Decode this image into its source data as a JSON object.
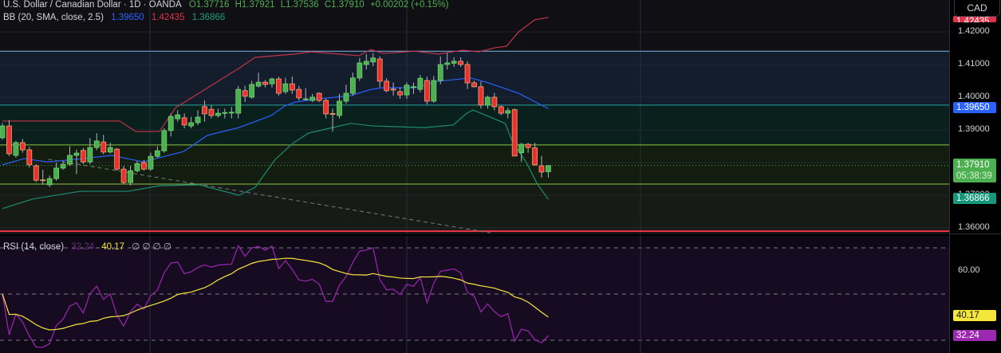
{
  "header": {
    "symbol": "U.S. Dollar / Canadian Dollar · 1D · OANDA",
    "open": "O1.37716",
    "high": "H1.37921",
    "low": "L1.37536",
    "close": "C1.37910",
    "change": "+0.00202 (+0.15%)"
  },
  "bb_legend": {
    "label": "BB (20, SMA, close, 2.5)",
    "basis": "1.39650",
    "upper": "1.42435",
    "lower": "1.36866"
  },
  "rsi_legend": {
    "label": "RSI (14, close)",
    "rsi": "32.24",
    "ma": "40.17",
    "extras": "∅ ∅ ∅ ∅"
  },
  "currency_button": "CAD",
  "price_scale": {
    "ticks": [
      "1.42000",
      "1.41000",
      "1.40000",
      "1.39000",
      "1.37000",
      "1.36000"
    ],
    "upper_badge": "1.42435",
    "basis_badge": "1.39650",
    "last_price": "1.37910",
    "countdown": "05:38:39",
    "lower_badge": "1.36866"
  },
  "rsi_scale": {
    "tick": "60.00",
    "ma_badge": "40.17",
    "rsi_badge": "32.24"
  },
  "colors": {
    "up": "#4caf50",
    "down": "#e8322f",
    "down_border": "#f7a072",
    "basis": "#2962ff",
    "upper": "#c2334a",
    "lower": "#1e8c73",
    "rsi": "#9c27b0",
    "rsi_ma": "#f5e63b"
  },
  "chart_data": {
    "type": "candlestick",
    "title": "U.S. Dollar / Canadian Dollar · 1D · OANDA",
    "ylim": [
      1.356,
      1.43
    ],
    "candles_ohlc": [
      [
        1.3876,
        1.392,
        1.387,
        1.3912
      ],
      [
        1.3912,
        1.393,
        1.382,
        1.3827
      ],
      [
        1.3822,
        1.3866,
        1.3815,
        1.3861
      ],
      [
        1.3861,
        1.3872,
        1.383,
        1.3839
      ],
      [
        1.3839,
        1.3848,
        1.3785,
        1.3793
      ],
      [
        1.379,
        1.3795,
        1.374,
        1.3746
      ],
      [
        1.3747,
        1.3778,
        1.3732,
        1.3745
      ],
      [
        1.3732,
        1.376,
        1.3725,
        1.3751
      ],
      [
        1.3751,
        1.38,
        1.3745,
        1.3783
      ],
      [
        1.3783,
        1.3805,
        1.3778,
        1.3795
      ],
      [
        1.3795,
        1.385,
        1.379,
        1.3822
      ],
      [
        1.3822,
        1.384,
        1.3765,
        1.3829
      ],
      [
        1.3837,
        1.3845,
        1.3795,
        1.3802
      ],
      [
        1.3802,
        1.3875,
        1.3795,
        1.3846
      ],
      [
        1.3846,
        1.389,
        1.3838,
        1.3866
      ],
      [
        1.3863,
        1.3885,
        1.3825,
        1.3832
      ],
      [
        1.3832,
        1.386,
        1.3828,
        1.3846
      ],
      [
        1.3841,
        1.3845,
        1.3775,
        1.378
      ],
      [
        1.378,
        1.379,
        1.3734,
        1.3739
      ],
      [
        1.3739,
        1.379,
        1.373,
        1.3775
      ],
      [
        1.3775,
        1.3805,
        1.377,
        1.3797
      ],
      [
        1.38,
        1.3808,
        1.3775,
        1.378
      ],
      [
        1.378,
        1.383,
        1.3775,
        1.3819
      ],
      [
        1.3819,
        1.385,
        1.3815,
        1.3836
      ],
      [
        1.3836,
        1.3905,
        1.383,
        1.3898
      ],
      [
        1.3898,
        1.395,
        1.388,
        1.3941
      ],
      [
        1.3934,
        1.396,
        1.3925,
        1.3946
      ],
      [
        1.3937,
        1.395,
        1.3905,
        1.3915
      ],
      [
        1.3912,
        1.394,
        1.3905,
        1.3922
      ],
      [
        1.3922,
        1.396,
        1.3915,
        1.3939
      ],
      [
        1.3971,
        1.399,
        1.3925,
        1.3949
      ],
      [
        1.3963,
        1.3975,
        1.3935,
        1.3944
      ],
      [
        1.3944,
        1.3965,
        1.3938,
        1.3951
      ],
      [
        1.3952,
        1.3965,
        1.3935,
        1.3953
      ],
      [
        1.3953,
        1.397,
        1.3935,
        1.3954
      ],
      [
        1.3951,
        1.4035,
        1.3935,
        1.4024
      ],
      [
        1.402,
        1.4035,
        1.3985,
        1.4003
      ],
      [
        1.4,
        1.405,
        1.3995,
        1.4039
      ],
      [
        1.4034,
        1.4075,
        1.403,
        1.4046
      ],
      [
        1.4046,
        1.4053,
        1.403,
        1.4039
      ],
      [
        1.4041,
        1.406,
        1.403,
        1.4056
      ],
      [
        1.4056,
        1.4063,
        1.4005,
        1.4012
      ],
      [
        1.4017,
        1.406,
        1.401,
        1.4041
      ],
      [
        1.4041,
        1.4063,
        1.401,
        1.4022
      ],
      [
        1.4024,
        1.4035,
        1.399,
        1.3998
      ],
      [
        1.3995,
        1.4028,
        1.399,
        1.3995
      ],
      [
        1.399,
        1.401,
        1.3985,
        1.4
      ],
      [
        1.4012,
        1.4015,
        1.3985,
        1.399
      ],
      [
        1.399,
        1.3995,
        1.3935,
        1.3949
      ],
      [
        1.395,
        1.3965,
        1.3895,
        1.3949
      ],
      [
        1.3944,
        1.401,
        1.3935,
        1.3988
      ],
      [
        1.3988,
        1.4038,
        1.398,
        1.4012
      ],
      [
        1.4012,
        1.4075,
        1.4005,
        1.4059
      ],
      [
        1.4059,
        1.412,
        1.405,
        1.4105
      ],
      [
        1.41,
        1.4132,
        1.4085,
        1.411
      ],
      [
        1.4108,
        1.4135,
        1.4095,
        1.412
      ],
      [
        1.4117,
        1.4125,
        1.403,
        1.4049
      ],
      [
        1.4049,
        1.4058,
        1.4015,
        1.402
      ],
      [
        1.4025,
        1.4045,
        1.4005,
        1.4022
      ],
      [
        1.4017,
        1.403,
        1.3995,
        1.4007
      ],
      [
        1.4007,
        1.4045,
        1.3995,
        1.4037
      ],
      [
        1.403,
        1.4045,
        1.401,
        1.4032
      ],
      [
        1.4024,
        1.4068,
        1.4015,
        1.4058
      ],
      [
        1.4051,
        1.4063,
        1.3978,
        1.3988
      ],
      [
        1.3988,
        1.4065,
        1.3983,
        1.4051
      ],
      [
        1.4051,
        1.4125,
        1.404,
        1.41
      ],
      [
        1.41,
        1.4135,
        1.4085,
        1.4105
      ],
      [
        1.4104,
        1.4122,
        1.4093,
        1.411
      ],
      [
        1.411,
        1.4122,
        1.4093,
        1.41
      ],
      [
        1.41,
        1.411,
        1.4025,
        1.4044
      ],
      [
        1.4044,
        1.405,
        1.403,
        1.4032
      ],
      [
        1.4032,
        1.4048,
        1.3965,
        1.3976
      ],
      [
        1.3976,
        1.4005,
        1.3965,
        1.4
      ],
      [
        1.4,
        1.4013,
        1.396,
        1.3971
      ],
      [
        1.3971,
        1.3975,
        1.3945,
        1.3951
      ],
      [
        1.3951,
        1.3968,
        1.3935,
        1.3959
      ],
      [
        1.3962,
        1.3965,
        1.382,
        1.382
      ],
      [
        1.383,
        1.386,
        1.3802,
        1.3856
      ],
      [
        1.3856,
        1.386,
        1.383,
        1.3846
      ],
      [
        1.3845,
        1.386,
        1.379,
        1.3793
      ],
      [
        1.379,
        1.382,
        1.3754,
        1.3771
      ],
      [
        1.3772,
        1.3792,
        1.3754,
        1.3791
      ]
    ],
    "bb_upper": [
      [
        0,
        1.3927
      ],
      [
        17.4,
        1.3927
      ],
      [
        19.8,
        1.3895
      ],
      [
        23.3,
        1.3895
      ],
      [
        25.7,
        1.3968
      ],
      [
        35.2,
        1.409
      ],
      [
        37.5,
        1.4122
      ],
      [
        43.4,
        1.4132
      ],
      [
        45.8,
        1.4139
      ],
      [
        52.9,
        1.4127
      ],
      [
        54.7,
        1.4146
      ],
      [
        56.5,
        1.4134
      ],
      [
        61.2,
        1.4141
      ],
      [
        64.7,
        1.4132
      ],
      [
        68.3,
        1.4144
      ],
      [
        70.7,
        1.4139
      ],
      [
        73,
        1.4151
      ],
      [
        74.8,
        1.4156
      ],
      [
        76.6,
        1.42
      ],
      [
        79,
        1.4237
      ],
      [
        81,
        1.4244
      ]
    ],
    "bb_basis": [
      [
        0,
        1.3793
      ],
      [
        3.2,
        1.3812
      ],
      [
        6.7,
        1.3802
      ],
      [
        12,
        1.3812
      ],
      [
        16.2,
        1.3822
      ],
      [
        20.9,
        1.3802
      ],
      [
        26.9,
        1.3834
      ],
      [
        30.4,
        1.3883
      ],
      [
        35.1,
        1.3907
      ],
      [
        39.9,
        1.3944
      ],
      [
        41.9,
        1.3973
      ],
      [
        43.4,
        1.3985
      ],
      [
        47,
        1.3995
      ],
      [
        51.7,
        1.4005
      ],
      [
        54.7,
        1.4024
      ],
      [
        56.4,
        1.4029
      ],
      [
        61.2,
        1.4029
      ],
      [
        64.7,
        1.4049
      ],
      [
        69.5,
        1.4059
      ],
      [
        71.8,
        1.4046
      ],
      [
        76.6,
        1.4012
      ],
      [
        81,
        1.3965
      ]
    ],
    "bb_lower": [
      [
        0,
        1.3659
      ],
      [
        4.4,
        1.3688
      ],
      [
        11.5,
        1.3712
      ],
      [
        18.6,
        1.3712
      ],
      [
        23.3,
        1.3729
      ],
      [
        29.2,
        1.3732
      ],
      [
        35.1,
        1.37
      ],
      [
        37.5,
        1.3724
      ],
      [
        40.5,
        1.381
      ],
      [
        43.1,
        1.3859
      ],
      [
        45.4,
        1.389
      ],
      [
        49,
        1.3907
      ],
      [
        51.7,
        1.392
      ],
      [
        54.9,
        1.3912
      ],
      [
        62.7,
        1.3907
      ],
      [
        66.9,
        1.3915
      ],
      [
        68.9,
        1.3951
      ],
      [
        69.8,
        1.3961
      ],
      [
        71.8,
        1.3944
      ],
      [
        74.6,
        1.392
      ],
      [
        75.7,
        1.3863
      ],
      [
        77.8,
        1.3798
      ],
      [
        79.3,
        1.3737
      ],
      [
        81,
        1.3687
      ]
    ],
    "horizontal_levels": [
      1.4141,
      1.3976,
      1.3854,
      1.3734,
      1.359
    ],
    "trendline": [
      [
        6.8,
        1.381
      ],
      [
        72.4,
        1.3585
      ]
    ],
    "rsi_levels": [
      70,
      50,
      30
    ],
    "rsi_last": 32.24,
    "rsi_ma_last": 40.17
  }
}
